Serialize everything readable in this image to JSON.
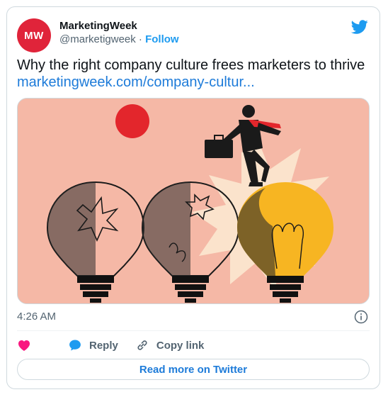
{
  "author": {
    "avatar_text": "MW",
    "name": "MarketingWeek",
    "handle": "@marketigweek",
    "separator": " · ",
    "follow_label": "Follow"
  },
  "tweet": {
    "text": "Why the right company culture frees marketers to thrive",
    "link_text": "marketingweek.com/company-cultur..."
  },
  "media": {
    "background_color": "#f5b8a6",
    "illustration": "businessman walking from broken light bulbs onto glowing light bulb"
  },
  "timestamp": "4:26 AM",
  "actions": {
    "like_icon": "heart-icon",
    "reply_label": "Reply",
    "copy_link_label": "Copy link"
  },
  "read_more_label": "Read more on Twitter",
  "colors": {
    "brand": "#e0243a",
    "accent": "#1d9bf0",
    "link": "#1d7bd9",
    "like": "#f91880"
  }
}
